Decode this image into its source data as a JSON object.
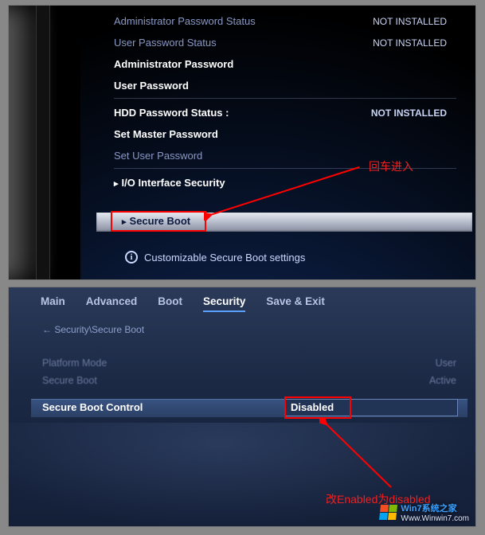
{
  "top": {
    "rows": [
      {
        "label": "Administrator Password Status",
        "value": "NOT INSTALLED",
        "dim": true
      },
      {
        "label": "User Password Status",
        "value": "NOT INSTALLED",
        "dim": true
      },
      {
        "label": "Administrator Password",
        "value": "",
        "bold": true
      },
      {
        "label": "User Password",
        "value": "",
        "bold": true
      },
      {
        "label": "HDD Password Status :",
        "value": "NOT INSTALLED",
        "bold": true,
        "divider_before": true
      },
      {
        "label": "Set Master Password",
        "value": "",
        "bold": true
      },
      {
        "label": "Set User Password",
        "value": "",
        "dim": true
      },
      {
        "label": "I/O Interface Security",
        "value": "",
        "bold": true,
        "chev": true,
        "divider_before": true
      }
    ],
    "selected": {
      "label": "Secure Boot"
    },
    "footer": "Customizable Secure Boot settings",
    "annotation": "回车进入"
  },
  "bottom": {
    "tabs": [
      "Main",
      "Advanced",
      "Boot",
      "Security",
      "Save & Exit"
    ],
    "active_tab": 3,
    "breadcrumb": "Security\\Secure Boot",
    "faint_rows": [
      {
        "label": "Platform Mode",
        "value": "User"
      },
      {
        "label": "Secure Boot",
        "value": "Active"
      }
    ],
    "control": {
      "label": "Secure Boot Control",
      "value": "Disabled"
    },
    "annotation": "改Enabled为disabled",
    "watermark": {
      "line1": "Win7系统之家",
      "line2": "Www.Winwin7.com"
    }
  }
}
